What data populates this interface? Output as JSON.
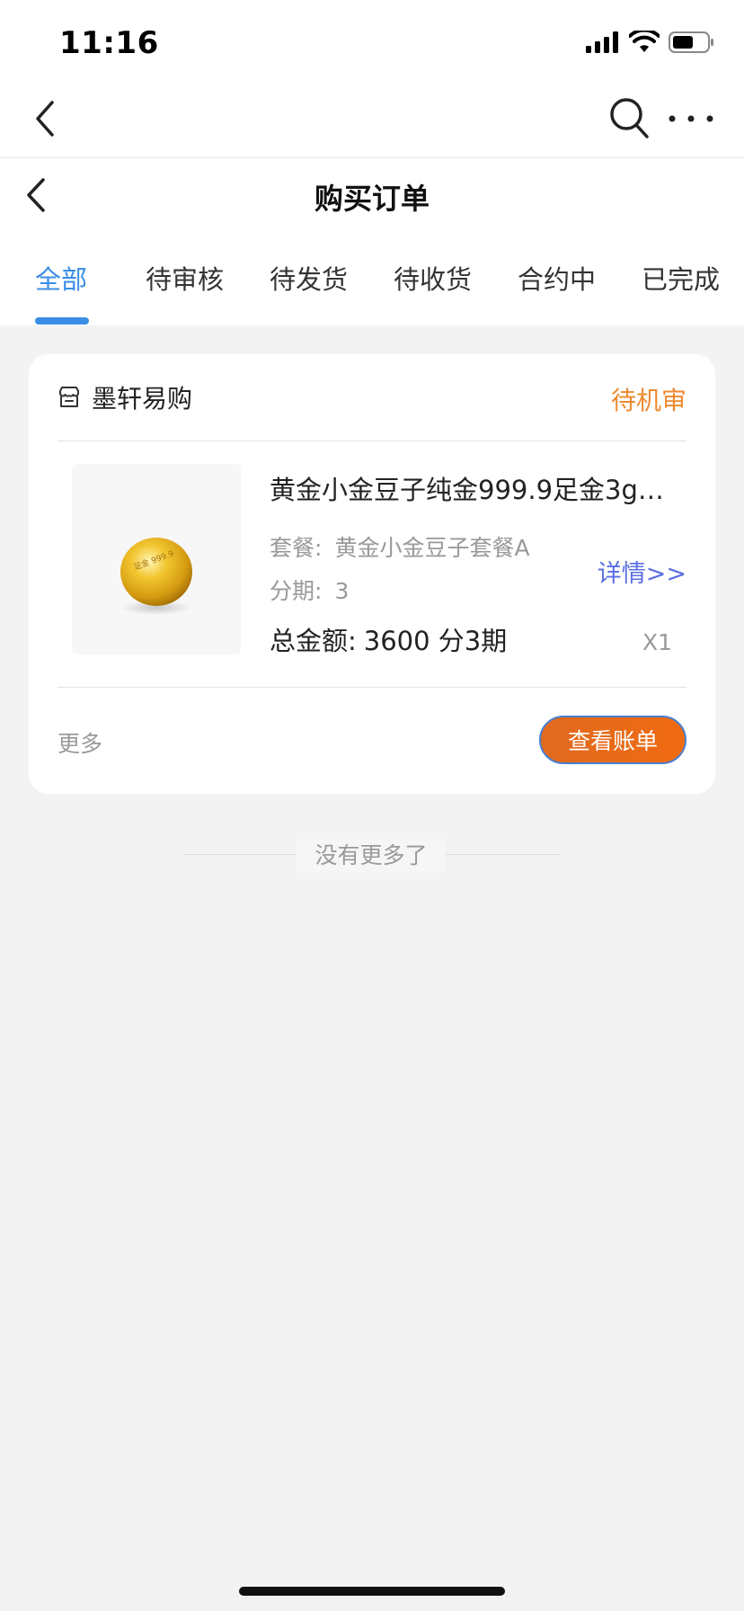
{
  "status_bar": {
    "time": "11:16"
  },
  "page": {
    "title": "购买订单"
  },
  "tabs": [
    {
      "label": "全部",
      "active": true
    },
    {
      "label": "待审核"
    },
    {
      "label": "待发货"
    },
    {
      "label": "待收货"
    },
    {
      "label": "合约中"
    },
    {
      "label": "已完成"
    }
  ],
  "order": {
    "shop_name": "墨轩易购",
    "status": "待机审",
    "product": {
      "name": "黄金小金豆子纯金999.9足金3g…",
      "image_text": "足金 999.9",
      "package_label": "套餐:",
      "package_value": "黄金小金豆子套餐A",
      "installment_label": "分期:",
      "installment_value": "3",
      "total_label": "总金额:",
      "total_value": "3600 分3期",
      "quantity": "X1",
      "detail_link": "详情>>"
    },
    "more_label": "更多",
    "view_bill_label": "查看账单"
  },
  "list_end_text": "没有更多了",
  "colors": {
    "accent": "#3a8ee6",
    "status": "#ee8a30",
    "link": "#5b6ee1",
    "button": "#ef6a10",
    "background": "#f3f3f3"
  }
}
